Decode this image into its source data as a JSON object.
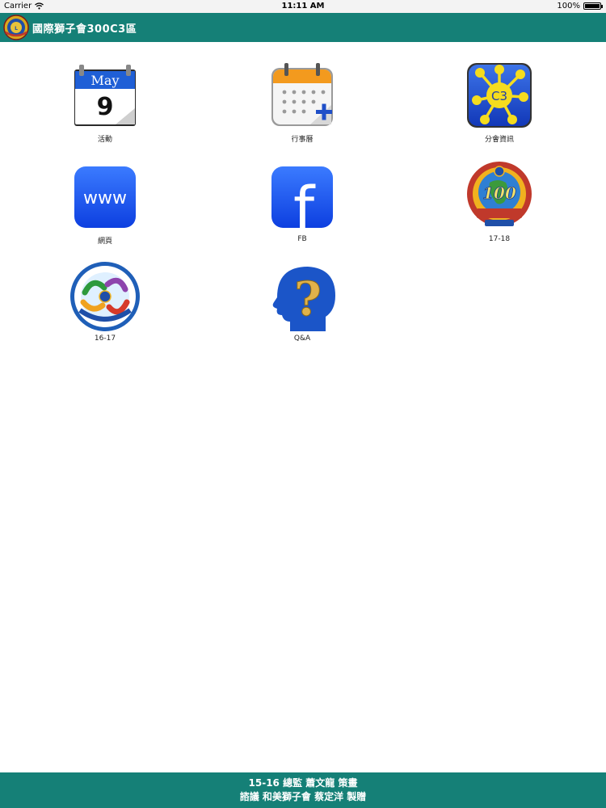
{
  "status_bar": {
    "carrier": "Carrier",
    "time": "11:11 AM",
    "battery": "100%",
    "battery_level": 1.0
  },
  "header": {
    "title": "國際獅子會300C3區",
    "logo_icon": "lions-district-logo"
  },
  "tiles": [
    {
      "label": "活動",
      "icon": "calendar-date-icon",
      "month": "May",
      "day": "9"
    },
    {
      "label": "行事曆",
      "icon": "calendar-add-icon"
    },
    {
      "label": "分會資訊",
      "icon": "club-network-icon",
      "badge_text": "C3"
    },
    {
      "label": "網頁",
      "icon": "web-icon",
      "badge_text": "www"
    },
    {
      "label": "FB",
      "icon": "facebook-icon",
      "badge_text": "f"
    },
    {
      "label": "17-18",
      "icon": "lions-100-emblem-icon",
      "badge_text": "100"
    },
    {
      "label": "16-17",
      "icon": "harmony-emblem-icon"
    },
    {
      "label": "Q&A",
      "icon": "question-head-icon",
      "badge_text": "?"
    }
  ],
  "footer": {
    "line1": "15-16 總監 蕭文龍 策畫",
    "line2": "諮議 和美獅子會 蔡定洋 製贈"
  },
  "colors": {
    "brand": "#158077",
    "status_bar": "#f3f3f3",
    "background": "#ffffff"
  }
}
